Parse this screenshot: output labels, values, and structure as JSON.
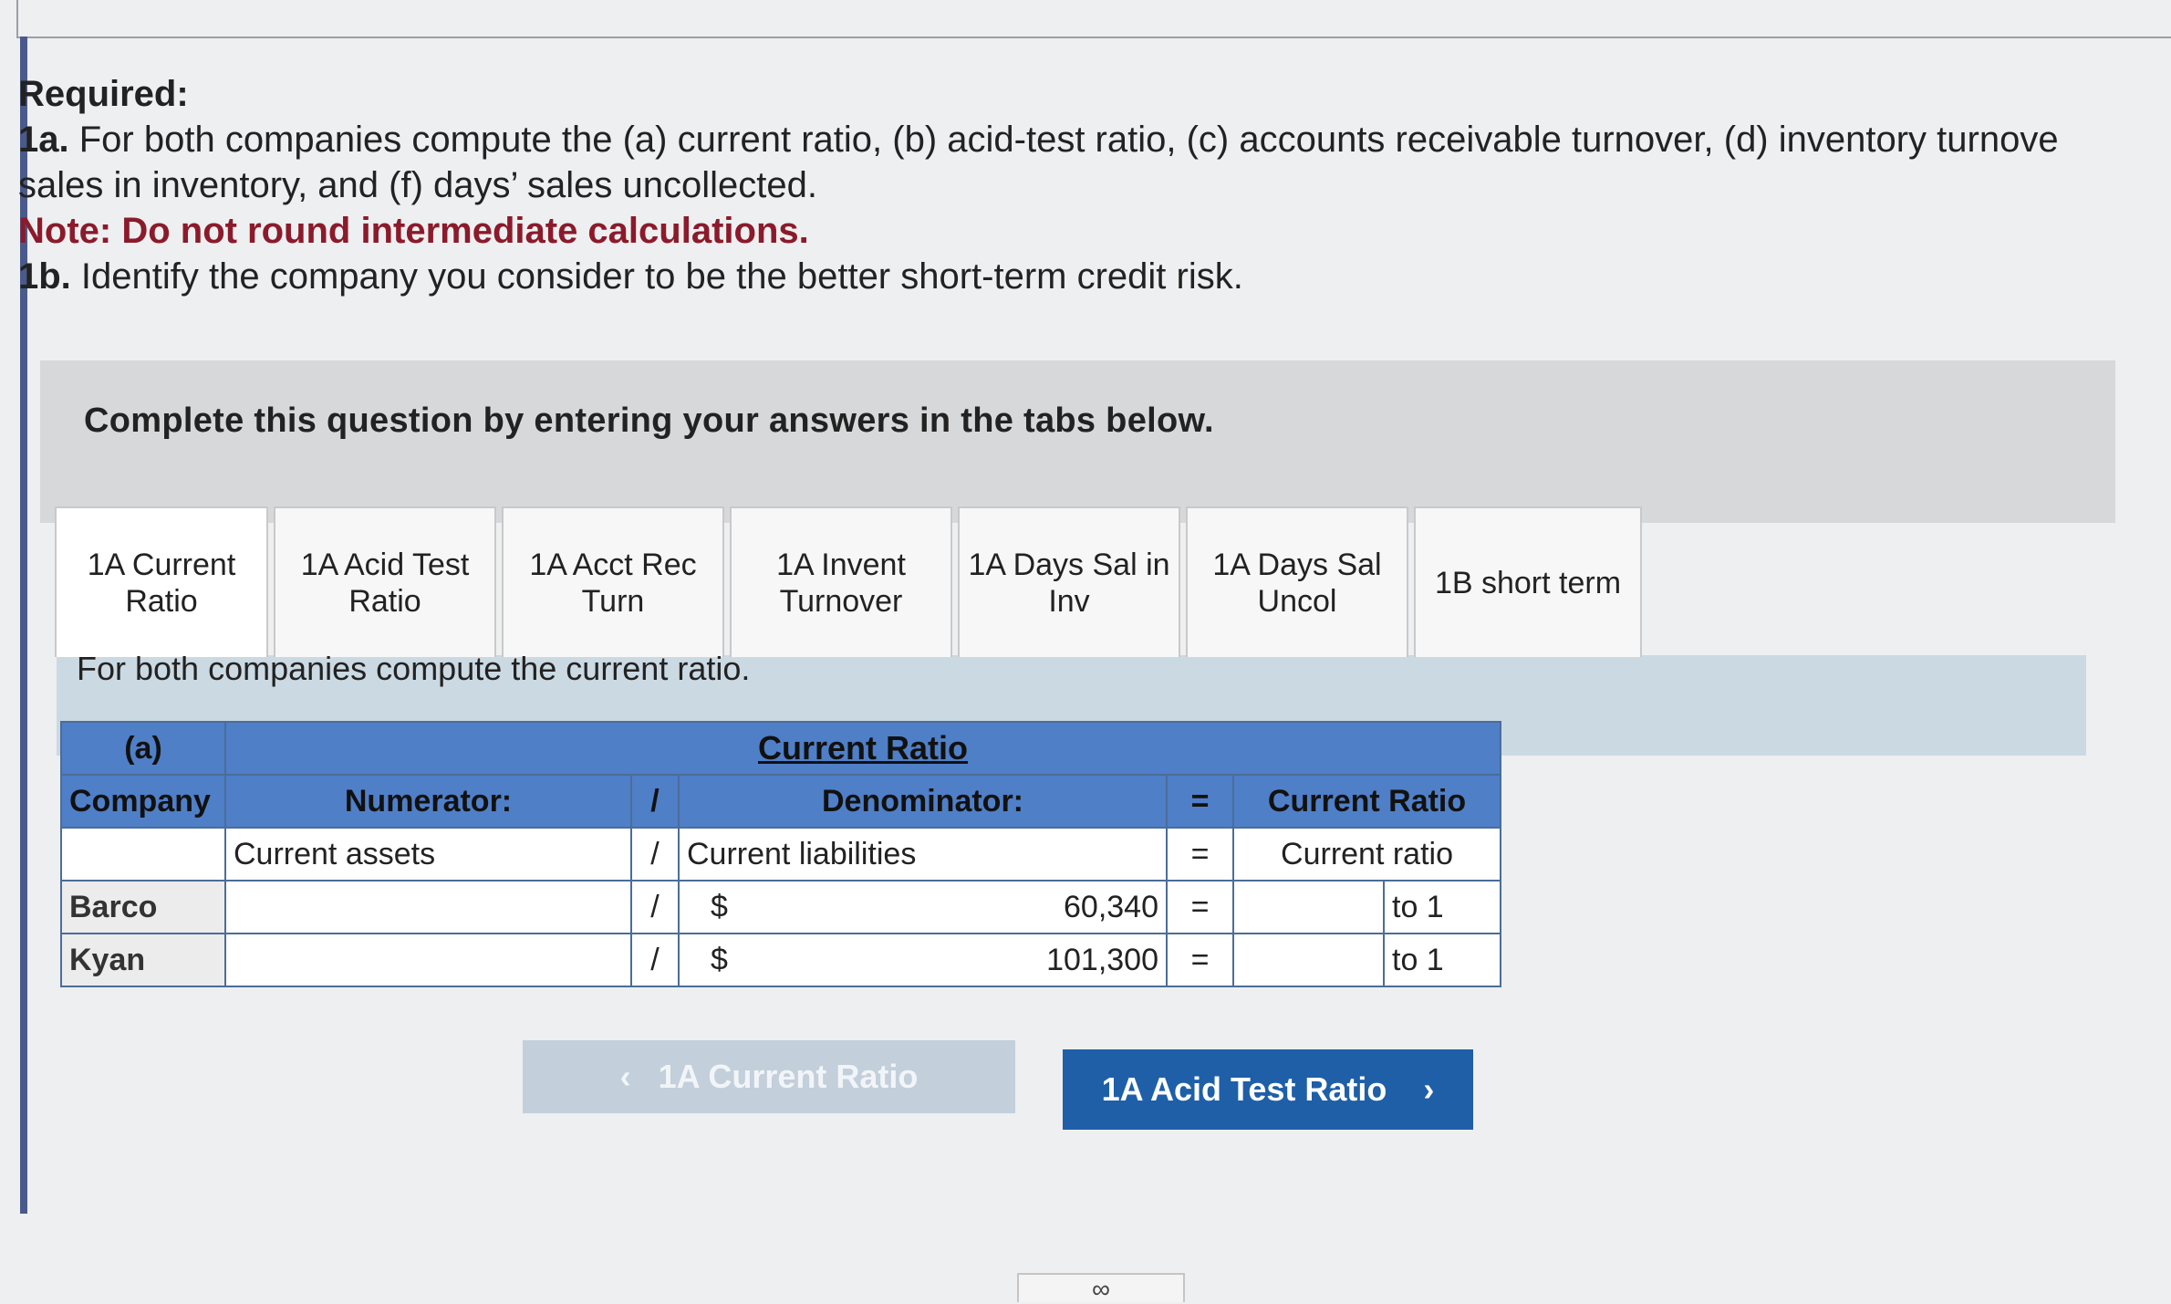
{
  "required": {
    "heading": "Required:",
    "line1_prefix": "1a.",
    "line1_text": "For both companies compute the (a) current ratio, (b) acid-test ratio, (c) accounts receivable turnover, (d) inventory turnove",
    "line2_text": "sales in inventory, and (f) days’ sales uncollected.",
    "note": "Note: Do not round intermediate calculations.",
    "line3_prefix": "1b.",
    "line3_text": "Identify the company you consider to be the better short-term credit risk."
  },
  "banner": "Complete this question by entering your answers in the tabs below.",
  "tabs": [
    {
      "label": "1A Current Ratio"
    },
    {
      "label": "1A Acid Test Ratio"
    },
    {
      "label": "1A Acct Rec Turn"
    },
    {
      "label": "1A Invent Turnover"
    },
    {
      "label": "1A Days Sal in Inv"
    },
    {
      "label": "1A Days Sal Uncol"
    },
    {
      "label": "1B short term"
    }
  ],
  "instruction": "For both companies compute the current ratio.",
  "table": {
    "part": "(a)",
    "title": "Current Ratio",
    "col_company": "Company",
    "col_numerator": "Numerator:",
    "col_div": "/",
    "col_denominator": "Denominator:",
    "col_eq": "=",
    "col_result": "Current Ratio",
    "label_row": {
      "numerator": "Current assets",
      "div": "/",
      "denominator": "Current liabilities",
      "eq": "=",
      "result": "Current ratio"
    },
    "rows": [
      {
        "company": "Barco",
        "numerator": "",
        "div": "/",
        "currency": "$",
        "denominator": "60,340",
        "eq": "=",
        "result": "",
        "suffix": "to 1"
      },
      {
        "company": "Kyan",
        "numerator": "",
        "div": "/",
        "currency": "$",
        "denominator": "101,300",
        "eq": "=",
        "result": "",
        "suffix": "to 1"
      }
    ]
  },
  "nav": {
    "prev_label": "1A Current Ratio",
    "next_label": "1A Acid Test Ratio"
  },
  "icons": {
    "prev": "chevron-left-icon",
    "next": "chevron-right-icon",
    "link": "link-icon"
  }
}
